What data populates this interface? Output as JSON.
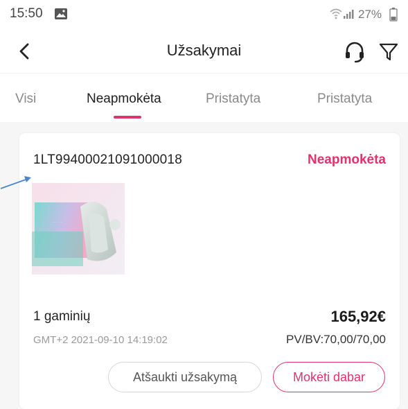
{
  "status_bar": {
    "time": "15:50",
    "battery": "27%"
  },
  "header": {
    "title": "Užsakymai"
  },
  "tabs": [
    {
      "label": "Visi"
    },
    {
      "label": "Neapmokėta"
    },
    {
      "label": "Pristatyta"
    },
    {
      "label": "Pristatyta"
    }
  ],
  "order": {
    "number": "1LT99400021091000018",
    "status": "Neapmokėta",
    "item_count": "1 gaminių",
    "price": "165,92€",
    "date": "GMT+2 2021-09-10 14:19:02",
    "pvbv": "PV/BV:70,00/70,00",
    "cancel_label": "Atšaukti užsakymą",
    "pay_label": "Mokėti dabar"
  },
  "colors": {
    "accent": "#e0326b",
    "background": "#f6f6f7",
    "annotation": "#4a86c8"
  },
  "icons": {
    "back": "chevron-left-icon",
    "support": "headset-icon",
    "filter": "filter-icon"
  }
}
